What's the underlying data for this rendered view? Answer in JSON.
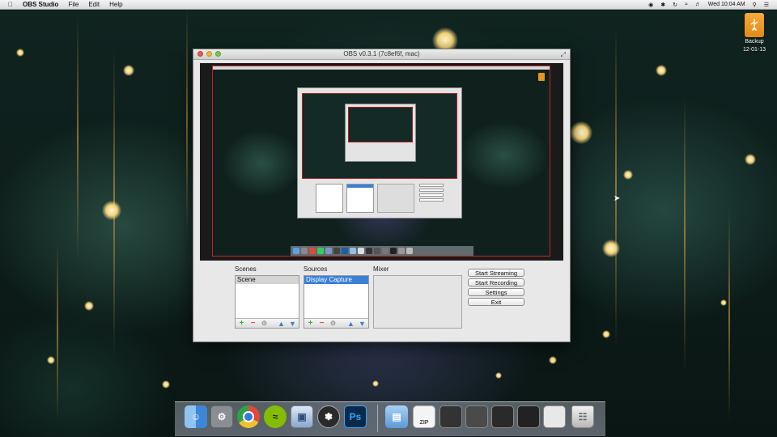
{
  "menubar": {
    "app_name": "OBS Studio",
    "menus": [
      "File",
      "Edit",
      "Help"
    ],
    "clock": "Wed 10:04 AM"
  },
  "desktop": {
    "drive_name": "Backup",
    "drive_date": "12-01-13"
  },
  "window": {
    "title": "OBS v0.3.1 (7c8ef6f, mac)"
  },
  "scenes": {
    "label": "Scenes",
    "items": [
      "Scene"
    ]
  },
  "sources": {
    "label": "Sources",
    "items": [
      "Display Capture"
    ]
  },
  "mixer": {
    "label": "Mixer"
  },
  "buttons": {
    "start_streaming": "Start Streaming",
    "start_recording": "Start Recording",
    "settings": "Settings",
    "exit": "Exit"
  },
  "toolbar_glyphs": {
    "add": "+",
    "remove": "−",
    "props": "⚙",
    "up": "▲",
    "down": "▼"
  },
  "dock": {
    "ps_label": "Ps",
    "zip_label": "ZIP"
  },
  "colors": {
    "selection_blue": "#3b7fd6",
    "preview_border": "#c0262b",
    "add_green": "#3fae3c",
    "remove_red": "#d9534f"
  }
}
